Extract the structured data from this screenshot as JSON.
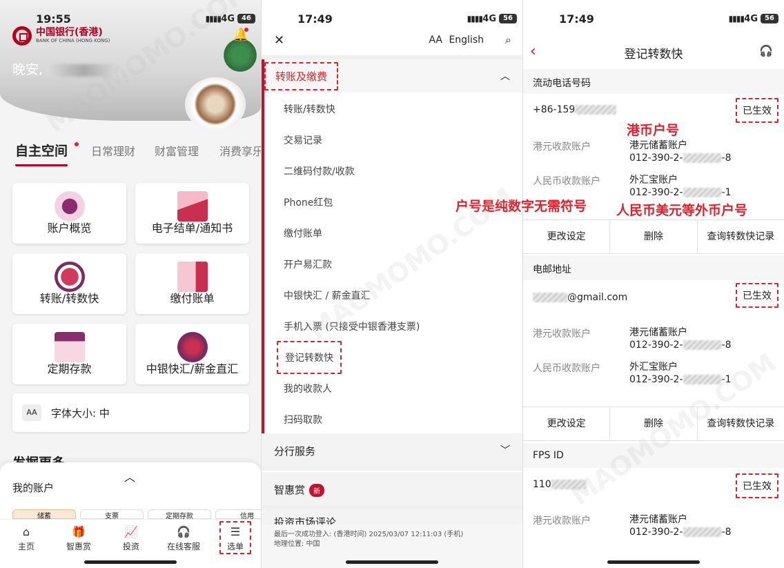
{
  "colors": {
    "brand": "#b6001e",
    "accent": "#c8102e",
    "annotation": "#e1202a"
  },
  "watermark": "MAOMOMO.COM",
  "panel1": {
    "time": "19:55",
    "network": "4G",
    "battery": "46",
    "bank_name": "中国银行(香港)",
    "bank_sub": "BANK OF CHINA (HONG KONG)",
    "greeting": "晚安,",
    "tabs": [
      "自主空间",
      "日常理财",
      "财富管理",
      "消费享乐"
    ],
    "cards": [
      "账户概览",
      "电子结单/通知书",
      "转账/转数快",
      "缴付账单",
      "定期存款",
      "中银快汇/薪金直汇"
    ],
    "font_label": "字体大小:",
    "font_value": "中",
    "aa": "AA",
    "discover": "发掘更多",
    "sheet_title": "我的账户",
    "chips": [
      "储蓄",
      "支票",
      "定期存款",
      "信用"
    ],
    "nav": [
      {
        "label": "主页",
        "icon": "home-icon"
      },
      {
        "label": "智惠赏",
        "icon": "gift-icon"
      },
      {
        "label": "投资",
        "icon": "chart-icon"
      },
      {
        "label": "在线客服",
        "icon": "headset-icon"
      },
      {
        "label": "选单",
        "icon": "menu-icon"
      }
    ]
  },
  "panel2": {
    "time": "17:49",
    "network": "4G",
    "battery": "56",
    "font_btn": "AA",
    "language": "English",
    "section1": "转账及缴费",
    "items": [
      "转账/转数快",
      "交易记录",
      "二维码付款/收款",
      "Phone红包",
      "缴付账单",
      "开户易汇款",
      "中银快汇 / 薪金直汇",
      "手机入票 (只接受中银香港支票)",
      "登记转数快",
      "我的收款人",
      "扫码取款"
    ],
    "section2": "分行服务",
    "section3": "智惠赏",
    "new_badge": "新",
    "section4": "投资市场评论",
    "footer_line1": "最后一次成功登入: (香港时间) 2025/03/07 12:11:03 (手机)",
    "footer_line2": "地理位置: 中国"
  },
  "panel3": {
    "time": "17:49",
    "network": "4G",
    "battery": "56",
    "title": "登记转数快",
    "phone_header": "流动电话号码",
    "phone_value": "+86-159",
    "status": "已生效",
    "hkd_label": "港元收款账户",
    "hkd_acc_name": "港元储蓄账户",
    "hkd_acc_prefix": "012-390-2-",
    "hkd_acc_suffix": "-8",
    "rmb_label": "人民币收款账户",
    "rmb_acc_name": "外汇宝账户",
    "rmb_acc_prefix": "012-390-2-",
    "rmb_acc_suffix": "-1",
    "buttons": [
      "更改设定",
      "删除",
      "查询转数快记录"
    ],
    "email_header": "电邮地址",
    "email_value": "@gmail.com",
    "fps_header": "FPS ID",
    "fps_value": "110"
  },
  "annotations": {
    "hkd": "港币户号",
    "pure_digits": "户号是纯数字无需符号",
    "foreign": "人民币美元等外币户号"
  }
}
